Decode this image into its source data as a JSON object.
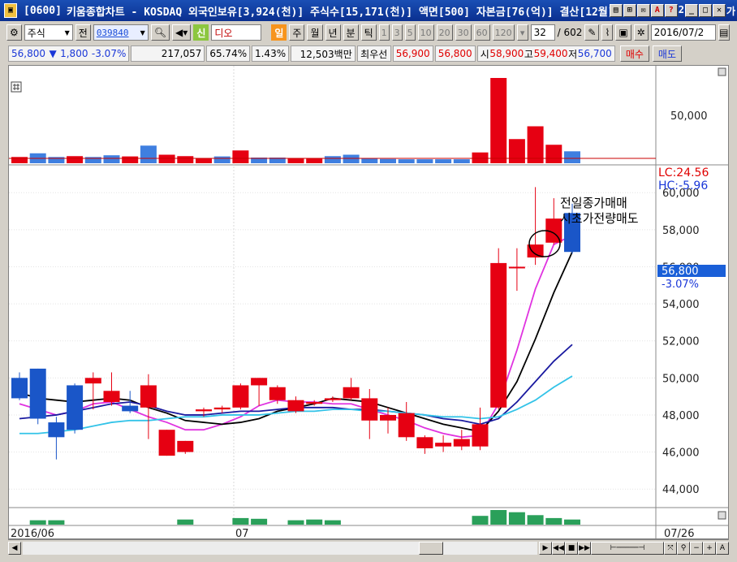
{
  "window": {
    "screen_id": "[0600]",
    "title": "키움종합차트 - KOSDAQ 외국인보유[3,924(천)] 주식수[15,171(천)] 액면[500] 자본금[76(억)] 결산[12월]",
    "overflow_text": "2",
    "cut_text": "가"
  },
  "toolbar": {
    "type_select": "주식",
    "prev_label": "전",
    "code": "039840",
    "new_label": "신",
    "stock_name": "디오",
    "periods": [
      "일",
      "주",
      "월",
      "년",
      "분",
      "틱"
    ],
    "active_period": "일",
    "intervals": [
      "1",
      "3",
      "5",
      "10",
      "20",
      "30",
      "60",
      "120"
    ],
    "count_value": "32",
    "total_count": "/ 602",
    "date": "2016/07/2"
  },
  "quote": {
    "price": "56,800",
    "change_arrow": "▼",
    "change": "1,800",
    "change_pct": "-3.07%",
    "volume": "217,057",
    "ratio1": "65.74%",
    "ratio2": "1.43%",
    "amount": "12,503백만",
    "priority_label": "최우선",
    "bid": "56,900",
    "ask": "56,800",
    "open_label": "시",
    "open": "58,900",
    "high_label": "고",
    "high": "59,400",
    "low_label": "저",
    "low": "56,700",
    "buy_label": "매수",
    "sell_label": "매도"
  },
  "chart_data": {
    "type": "candlestick",
    "x_labels": [
      "2016/06",
      "07",
      "07/26"
    ],
    "ylim": [
      43000,
      61500
    ],
    "y_ticks": [
      "44,000",
      "46,000",
      "48,000",
      "50,000",
      "52,000",
      "54,000",
      "56,000",
      "58,000",
      "60,000"
    ],
    "lc_label": "LC:24.56",
    "hc_label": "HC:-5.96",
    "last_price_label": "56,800",
    "last_change_label": "-3.07%",
    "upper_tick": "50,000",
    "annotation": [
      "전일종가매매",
      "시초가전량매도"
    ],
    "candles": [
      {
        "o": 50000,
        "c": 48900,
        "h": 50300,
        "l": 48800
      },
      {
        "o": 50500,
        "c": 47800,
        "h": 50500,
        "l": 47500
      },
      {
        "o": 47600,
        "c": 46800,
        "h": 47900,
        "l": 45600
      },
      {
        "o": 49600,
        "c": 47200,
        "h": 49700,
        "l": 47000
      },
      {
        "o": 49700,
        "c": 50000,
        "h": 50300,
        "l": 48300
      },
      {
        "o": 48700,
        "c": 49300,
        "h": 50300,
        "l": 48500
      },
      {
        "o": 48500,
        "c": 48200,
        "h": 49300,
        "l": 48100
      },
      {
        "o": 48400,
        "c": 49600,
        "h": 50200,
        "l": 46700
      },
      {
        "o": 45800,
        "c": 47200,
        "h": 47200,
        "l": 45800
      },
      {
        "o": 46000,
        "c": 46600,
        "h": 46600,
        "l": 45900
      },
      {
        "o": 48200,
        "c": 48300,
        "h": 48400,
        "l": 47900
      },
      {
        "o": 48300,
        "c": 48400,
        "h": 48500,
        "l": 48100
      },
      {
        "o": 48400,
        "c": 49600,
        "h": 49700,
        "l": 48300
      },
      {
        "o": 49600,
        "c": 50000,
        "h": 50000,
        "l": 48500
      },
      {
        "o": 48800,
        "c": 49500,
        "h": 49600,
        "l": 48600
      },
      {
        "o": 48200,
        "c": 48800,
        "h": 49000,
        "l": 48100
      },
      {
        "o": 48600,
        "c": 48700,
        "h": 48800,
        "l": 48500
      },
      {
        "o": 48800,
        "c": 48900,
        "h": 49000,
        "l": 48700
      },
      {
        "o": 48900,
        "c": 49500,
        "h": 50000,
        "l": 48800
      },
      {
        "o": 47700,
        "c": 48900,
        "h": 49400,
        "l": 46700
      },
      {
        "o": 47700,
        "c": 48000,
        "h": 48400,
        "l": 47000
      },
      {
        "o": 46800,
        "c": 48100,
        "h": 48700,
        "l": 46600
      },
      {
        "o": 46200,
        "c": 46800,
        "h": 46900,
        "l": 45900
      },
      {
        "o": 46300,
        "c": 46500,
        "h": 46900,
        "l": 46000
      },
      {
        "o": 46300,
        "c": 46700,
        "h": 47200,
        "l": 46100
      },
      {
        "o": 46300,
        "c": 47500,
        "h": 48400,
        "l": 46100
      },
      {
        "o": 48400,
        "c": 56200,
        "h": 57000,
        "l": 48300
      },
      {
        "o": 56000,
        "c": 56000,
        "h": 57000,
        "l": 54700
      },
      {
        "o": 56500,
        "c": 57200,
        "h": 60300,
        "l": 56100
      },
      {
        "o": 57300,
        "c": 58600,
        "h": 59700,
        "l": 57200
      },
      {
        "o": 58900,
        "c": 56800,
        "h": 59400,
        "l": 56700
      }
    ],
    "series": [
      {
        "name": "",
        "color": "#e033e0",
        "values": [
          48600,
          48300,
          48000,
          48200,
          48600,
          48700,
          48300,
          47900,
          47600,
          47200,
          47200,
          47500,
          47900,
          48500,
          48800,
          48700,
          48700,
          48600,
          48600,
          48300,
          48000,
          47700,
          47300,
          47000,
          46800,
          46900,
          48600,
          51500,
          54800,
          57200,
          57700
        ]
      },
      {
        "name": "",
        "color": "#000000",
        "values": [
          49200,
          48900,
          48800,
          48700,
          48800,
          48900,
          48800,
          48400,
          48100,
          47700,
          47600,
          47500,
          47600,
          47800,
          48200,
          48400,
          48600,
          48900,
          48800,
          48700,
          48400,
          48100,
          47800,
          47500,
          47300,
          47100,
          48200,
          49800,
          52100,
          54600,
          56800
        ]
      },
      {
        "name": "",
        "color": "#1a1aa0",
        "values": [
          47800,
          47900,
          48000,
          48200,
          48400,
          48600,
          48700,
          48500,
          48200,
          48000,
          48000,
          48100,
          48200,
          48200,
          48300,
          48400,
          48400,
          48400,
          48300,
          48300,
          48200,
          48100,
          48000,
          47800,
          47700,
          47500,
          47800,
          48700,
          49800,
          50900,
          51800
        ]
      },
      {
        "name": "",
        "color": "#33c3e8",
        "values": [
          47000,
          47000,
          47100,
          47200,
          47400,
          47600,
          47700,
          47700,
          47800,
          47900,
          47900,
          48000,
          48000,
          48000,
          48100,
          48200,
          48200,
          48300,
          48300,
          48200,
          48200,
          48100,
          48000,
          47900,
          47900,
          47800,
          47900,
          48300,
          48800,
          49500,
          50100
        ]
      }
    ],
    "upper_bars": [
      {
        "v": 0.22,
        "c": "red"
      },
      {
        "v": 0.35,
        "c": "blue"
      },
      {
        "v": 0.22,
        "c": "blue"
      },
      {
        "v": 0.25,
        "c": "red"
      },
      {
        "v": 0.22,
        "c": "blue"
      },
      {
        "v": 0.28,
        "c": "blue"
      },
      {
        "v": 0.24,
        "c": "red"
      },
      {
        "v": 0.62,
        "c": "blue"
      },
      {
        "v": 0.3,
        "c": "red"
      },
      {
        "v": 0.25,
        "c": "red"
      },
      {
        "v": 0.18,
        "c": "red"
      },
      {
        "v": 0.24,
        "c": "blue"
      },
      {
        "v": 0.45,
        "c": "red"
      },
      {
        "v": 0.2,
        "c": "blue"
      },
      {
        "v": 0.2,
        "c": "blue"
      },
      {
        "v": 0.18,
        "c": "red"
      },
      {
        "v": 0.16,
        "c": "red"
      },
      {
        "v": 0.25,
        "c": "blue"
      },
      {
        "v": 0.3,
        "c": "blue"
      },
      {
        "v": 0.17,
        "c": "blue"
      },
      {
        "v": 0.15,
        "c": "blue"
      },
      {
        "v": 0.14,
        "c": "blue"
      },
      {
        "v": 0.14,
        "c": "blue"
      },
      {
        "v": 0.14,
        "c": "blue"
      },
      {
        "v": 0.14,
        "c": "blue"
      },
      {
        "v": 0.38,
        "c": "red"
      },
      {
        "v": 3.0,
        "c": "red"
      },
      {
        "v": 0.85,
        "c": "red"
      },
      {
        "v": 1.3,
        "c": "red"
      },
      {
        "v": 0.65,
        "c": "red"
      },
      {
        "v": 0.42,
        "c": "blue"
      }
    ],
    "lower_bars": [
      0,
      0.3,
      0.3,
      0,
      0,
      0,
      0,
      0,
      0,
      0.35,
      0,
      0,
      0.45,
      0.4,
      0,
      0.3,
      0.35,
      0.3,
      0,
      0,
      0,
      0,
      0,
      0,
      0,
      0.6,
      1.0,
      0.85,
      0.65,
      0.45,
      0.35
    ]
  }
}
